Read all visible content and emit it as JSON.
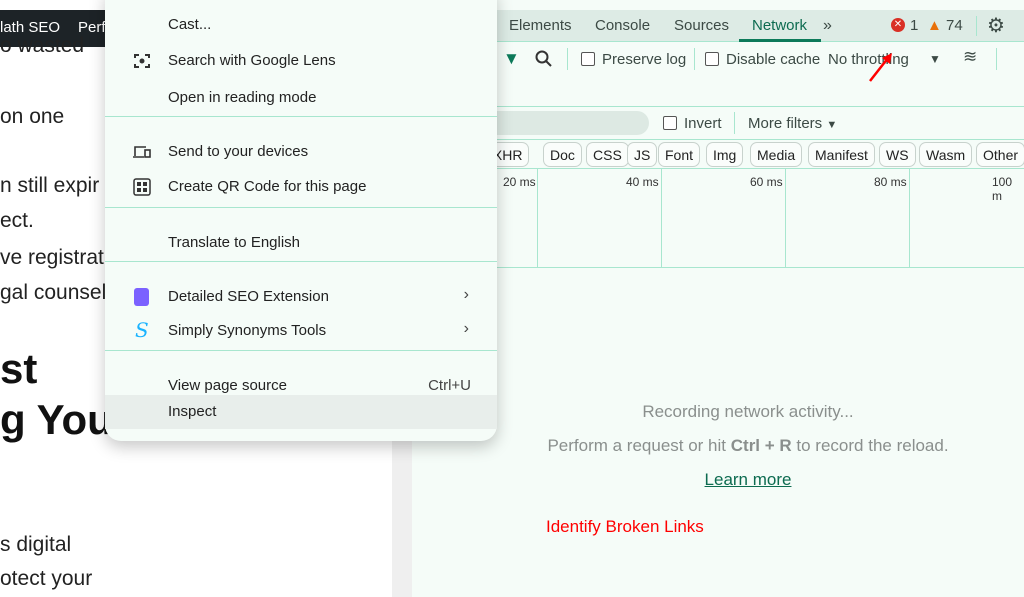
{
  "page": {
    "admin_bar": [
      "lath SEO",
      "Perfi"
    ],
    "lines": [
      "o wasted",
      "on one",
      "n still expir",
      "ect.",
      "ve registrati",
      "gal counsel.",
      "s digital",
      "otect your"
    ],
    "headings": [
      "st",
      "g You"
    ]
  },
  "devtools": {
    "tabs": [
      {
        "label": "Elements"
      },
      {
        "label": "Console"
      },
      {
        "label": "Sources"
      },
      {
        "label": "Network",
        "active": true
      }
    ],
    "more_tabs_icon": "chevron-double-right-icon",
    "errors": "1",
    "warnings": "74",
    "toolbar": {
      "preserve_log": "Preserve log",
      "disable_cache": "Disable cache",
      "throttling": "No throttling"
    },
    "filter": {
      "invert": "Invert",
      "more_filters": "More filters"
    },
    "chips": [
      "/XHR",
      "Doc",
      "CSS",
      "JS",
      "Font",
      "Img",
      "Media",
      "Manifest",
      "WS",
      "Wasm",
      "Other"
    ],
    "ticks": [
      "20 ms",
      "40 ms",
      "60 ms",
      "80 ms",
      "100 m"
    ],
    "empty": {
      "line1": "Recording network activity...",
      "line2_pre": "Perform a request or hit ",
      "line2_key": "Ctrl + R",
      "line2_post": " to record the reload.",
      "learn_more": "Learn more"
    },
    "annotation": "Identify Broken Links",
    "colors": {
      "accent": "#0d7a5a",
      "error": "#d93025",
      "warning": "#e8710a",
      "annotation": "#ff0000"
    }
  },
  "context_menu": {
    "items": [
      {
        "label": "Cast..."
      },
      {
        "label": "Search with Google Lens",
        "icon": "google-lens-icon"
      },
      {
        "label": "Open in reading mode"
      },
      {
        "label": "Send to your devices",
        "icon": "devices-icon"
      },
      {
        "label": "Create QR Code for this page",
        "icon": "qr-code-icon"
      },
      {
        "label": "Translate to English"
      },
      {
        "label": "Detailed SEO Extension",
        "icon": "detailed-seo-icon"
      },
      {
        "label": "Simply Synonyms Tools",
        "icon": "simply-synonyms-icon"
      },
      {
        "label": "View page source",
        "shortcut": "Ctrl+U"
      },
      {
        "label": "Inspect",
        "highlighted": true
      }
    ]
  }
}
